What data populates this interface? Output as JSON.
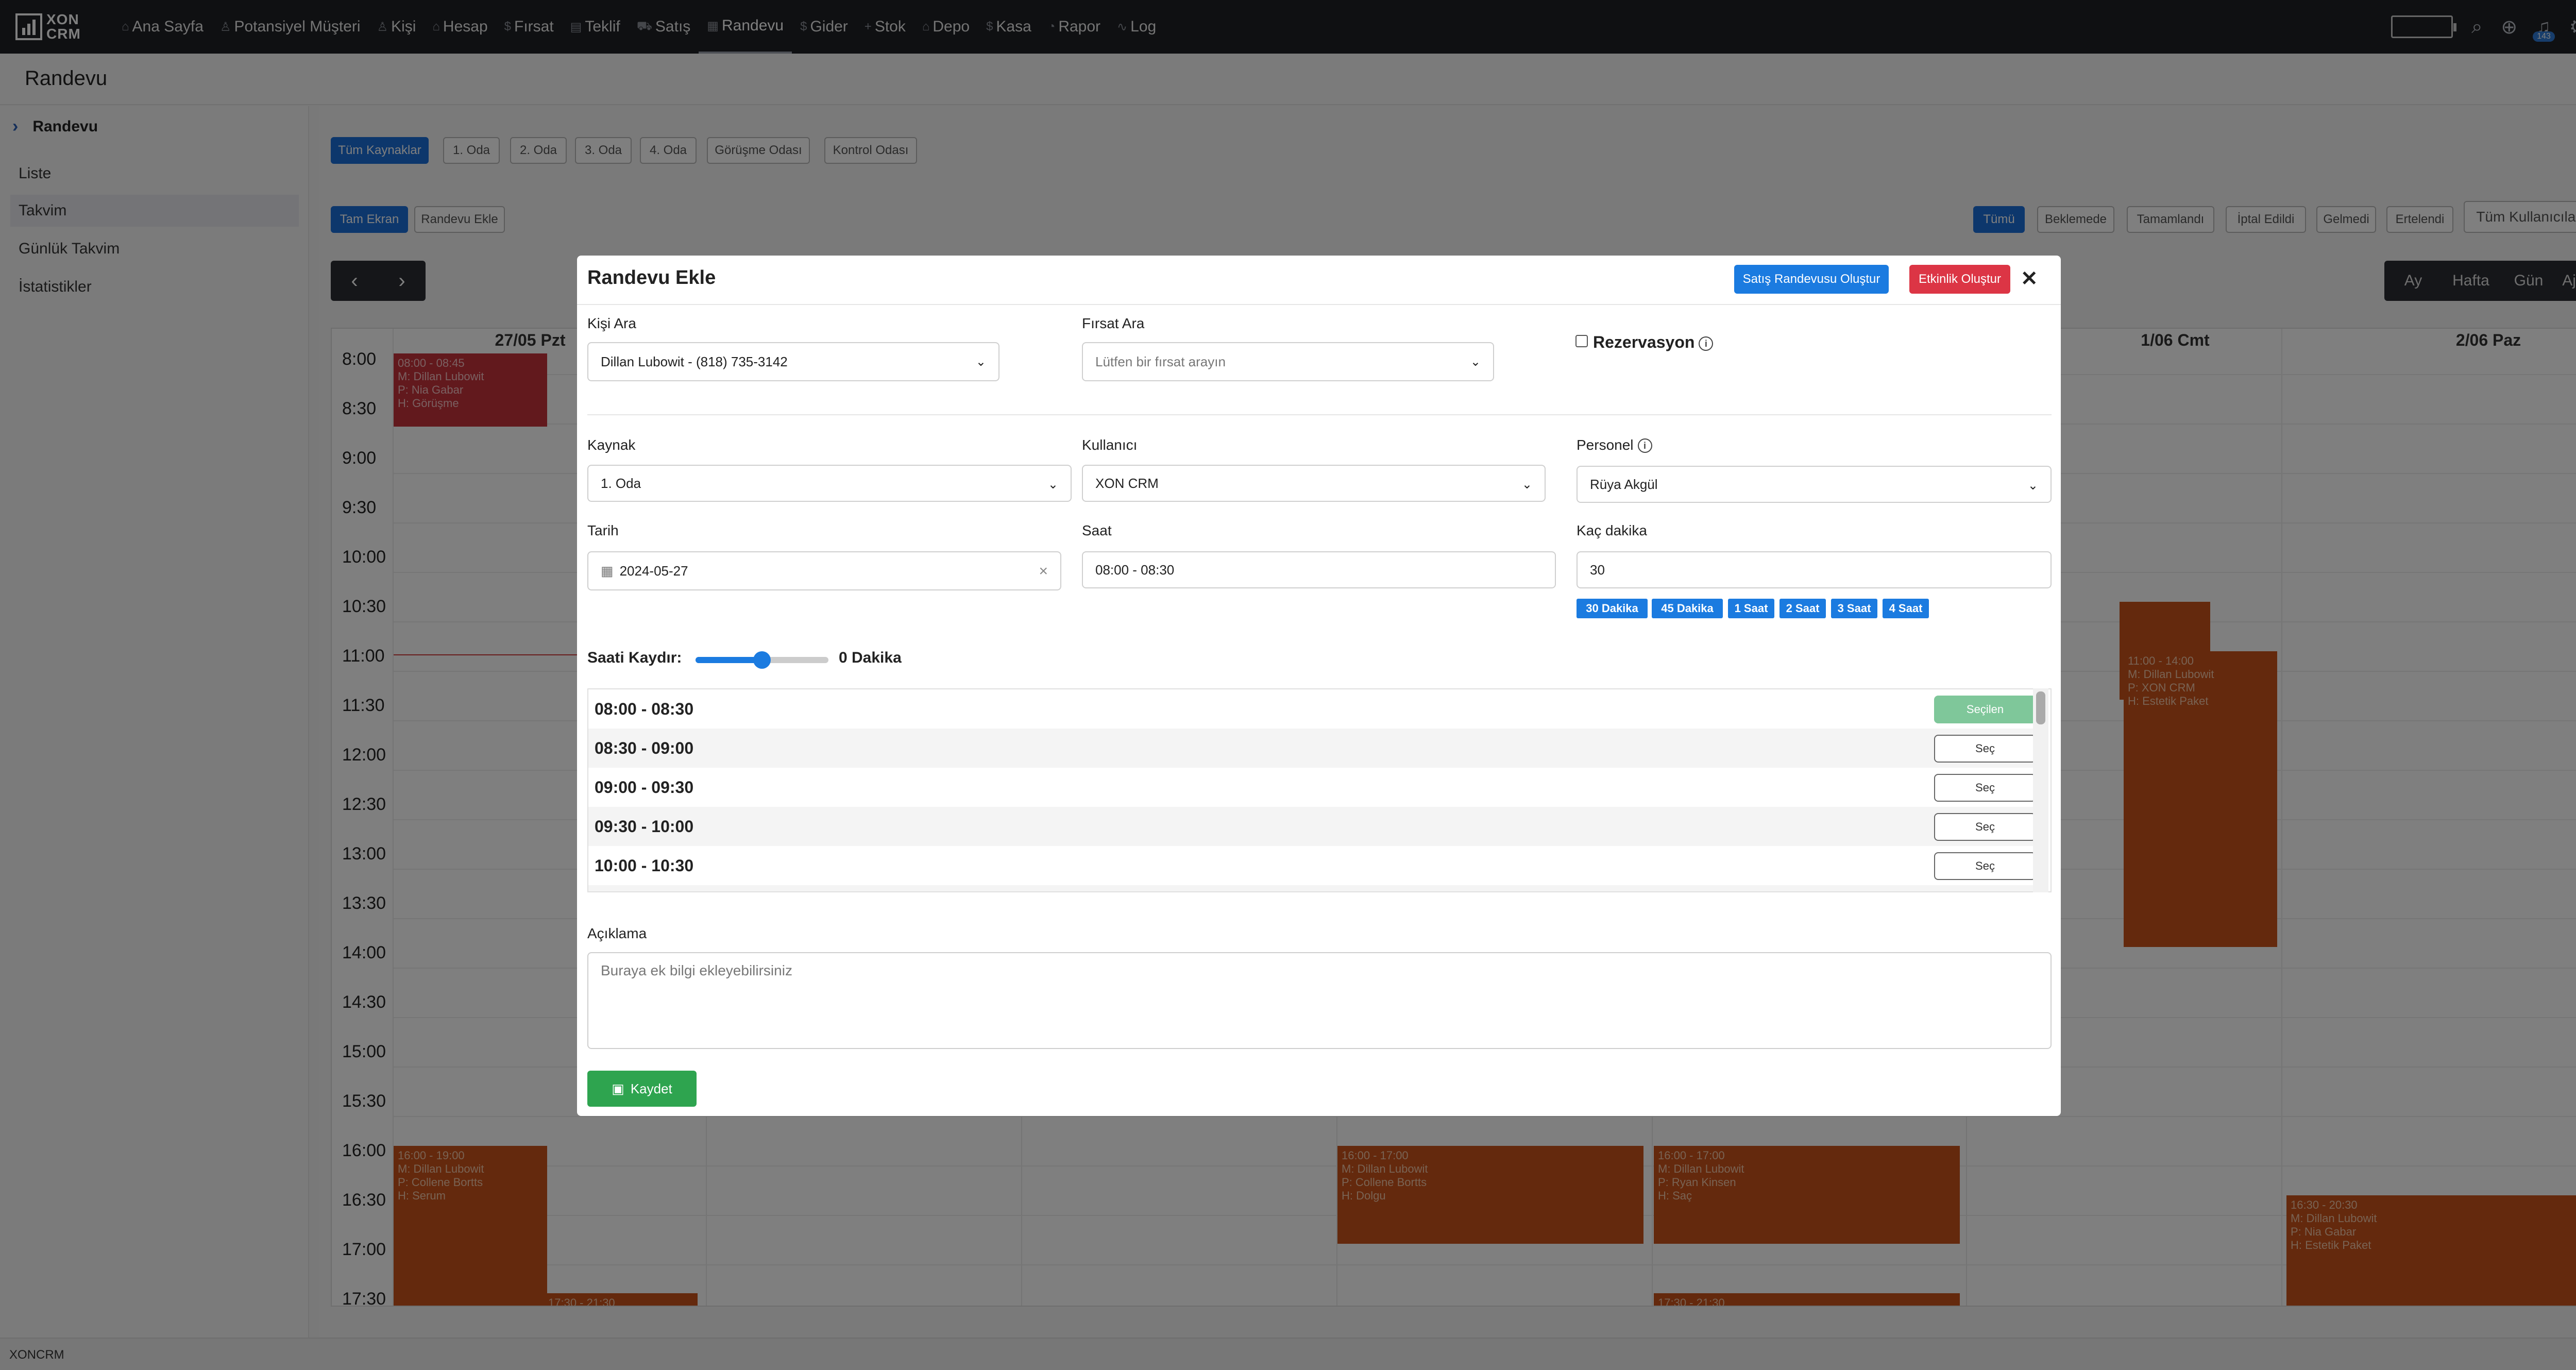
{
  "app": {
    "logo_text": "XON CRM",
    "footer": "XONCRM"
  },
  "nav": [
    {
      "label": "Ana Sayfa",
      "icon": "home-icon"
    },
    {
      "label": "Potansiyel Müşteri",
      "icon": "user-plus-icon"
    },
    {
      "label": "Kişi",
      "icon": "user-icon"
    },
    {
      "label": "Hesap",
      "icon": "building-icon"
    },
    {
      "label": "Fırsat",
      "icon": "dollar-icon"
    },
    {
      "label": "Teklif",
      "icon": "document-icon"
    },
    {
      "label": "Satış",
      "icon": "cart-icon"
    },
    {
      "label": "Randevu",
      "icon": "calendar-icon"
    },
    {
      "label": "Gider",
      "icon": "dollar-icon"
    },
    {
      "label": "Stok",
      "icon": "plus-icon"
    },
    {
      "label": "Depo",
      "icon": "warehouse-icon"
    },
    {
      "label": "Kasa",
      "icon": "cash-icon"
    },
    {
      "label": "Rapor",
      "icon": "chart-icon"
    },
    {
      "label": "Log",
      "icon": "activity-icon"
    }
  ],
  "topbar_right": {
    "notification_badge": "143"
  },
  "page": {
    "title": "Randevu"
  },
  "sidebar": {
    "header": "Randevu",
    "items": [
      "Liste",
      "Takvim",
      "Günlük Takvim",
      "İstatistikler"
    ]
  },
  "resources": [
    "Tüm Kaynaklar",
    "1. Oda",
    "2. Oda",
    "3. Oda",
    "4. Oda",
    "Görüşme Odası",
    "Kontrol Odası"
  ],
  "actions": [
    "Tam Ekran",
    "Randevu Ekle"
  ],
  "status_filters": [
    "Tümü",
    "Beklemede",
    "Tamamlandı",
    "İptal Edildi",
    "Gelmedi",
    "Ertelendi"
  ],
  "user_filter": "Tüm Kullanıcılar",
  "views": [
    "Ay",
    "Hafta",
    "Gün",
    "Ajanda"
  ],
  "calendar": {
    "days": [
      "27/05 Pzt",
      "1/06 Cmt",
      "2/06 Paz"
    ],
    "times": [
      "8:00",
      "8:30",
      "9:00",
      "9:30",
      "10:00",
      "10:30",
      "11:00",
      "11:30",
      "12:00",
      "12:30",
      "13:00",
      "13:30",
      "14:00",
      "14:30",
      "15:00",
      "15:30",
      "16:00",
      "16:30",
      "17:00",
      "17:30"
    ],
    "events": [
      {
        "time": "08:00 - 08:45",
        "m": "M: Dillan Lubowit",
        "p": "P: Nia Gabar",
        "h": "H: Görüşme"
      },
      {
        "time": "16:00 - 19:00",
        "m": "M: Dillan Lubowit",
        "p": "P: Collene Bortts",
        "h": "H: Serum"
      },
      {
        "time": "17:30 - 21:30",
        "m": "",
        "p": "",
        "h": ""
      },
      {
        "time": "16:00 - 17:00",
        "m": "M: Dillan Lubowit",
        "p": "P: Collene Bortts",
        "h": "H: Dolgu"
      },
      {
        "time": "16:00 - 17:00",
        "m": "M: Dillan Lubowit",
        "p": "P: Ryan Kinsen",
        "h": "H: Saç"
      },
      {
        "time": "17:30 - 21:30",
        "m": "",
        "p": "",
        "h": ""
      },
      {
        "time": "11:00 - 14:00",
        "m": "M: Dillan Lubowit",
        "p": "P: XON CRM",
        "h": "H: Estetik Paket"
      },
      {
        "time": "16:30 - 20:30",
        "m": "M: Dillan Lubowit",
        "p": "P: Nia Gabar",
        "h": "H: Estetik Paket"
      }
    ]
  },
  "modal": {
    "title": "Randevu Ekle",
    "btn_sales": "Satış Randevusu Oluştur",
    "btn_event": "Etkinlik Oluştur",
    "person_label": "Kişi Ara",
    "person_value": "Dillan Lubowit - (818) 735-3142",
    "opportunity_label": "Fırsat Ara",
    "opportunity_placeholder": "Lütfen bir fırsat arayın",
    "reservation_label": "Rezervasyon",
    "resource_label": "Kaynak",
    "resource_value": "1. Oda",
    "user_label": "Kullanıcı",
    "user_value": "XON CRM",
    "staff_label": "Personel",
    "staff_value": "Rüya Akgül",
    "date_label": "Tarih",
    "date_value": "2024-05-27",
    "time_label": "Saat",
    "time_value": "08:00 - 08:30",
    "minutes_label": "Kaç dakika",
    "minutes_value": "30",
    "duration_chips": [
      "30 Dakika",
      "45 Dakika",
      "1 Saat",
      "2 Saat",
      "3 Saat",
      "4 Saat"
    ],
    "shift_label": "Saati Kaydır:",
    "shift_value": "0 Dakika",
    "shift_slider_fraction": 0.5,
    "slots": [
      {
        "time": "08:00 - 08:30",
        "button": "Seçilen",
        "selected": true
      },
      {
        "time": "08:30 - 09:00",
        "button": "Seç",
        "selected": false
      },
      {
        "time": "09:00 - 09:30",
        "button": "Seç",
        "selected": false
      },
      {
        "time": "09:30 - 10:00",
        "button": "Seç",
        "selected": false
      },
      {
        "time": "10:00 - 10:30",
        "button": "Seç",
        "selected": false
      }
    ],
    "description_label": "Açıklama",
    "description_placeholder": "Buraya ek bilgi ekleyebilirsiniz",
    "save_label": "Kaydet"
  }
}
